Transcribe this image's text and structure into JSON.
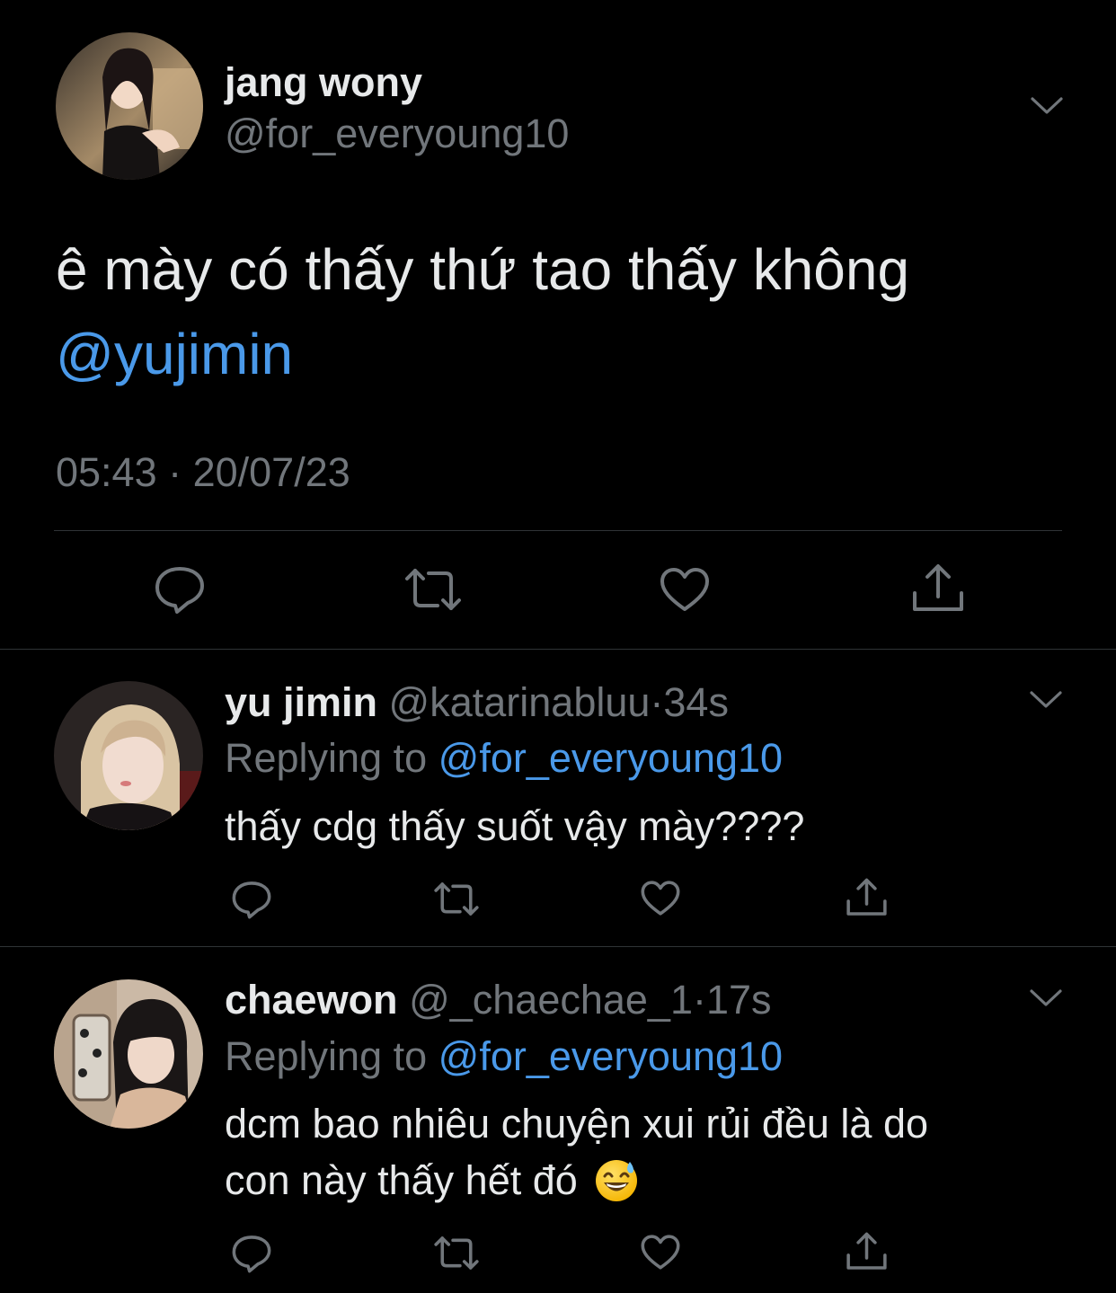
{
  "main_tweet": {
    "avatar_icon": "user-avatar-photo",
    "display_name": "jang wony",
    "handle": "@for_everyoung10",
    "text": "ê mày có thấy thứ tao thấy không",
    "mention": "@yujimin",
    "timestamp": "05:43 · 20/07/23",
    "actions": [
      "reply-icon",
      "retweet-icon",
      "like-icon",
      "share-icon"
    ]
  },
  "replies": [
    {
      "display_name": "yu jimin",
      "handle": "@katarinabluu",
      "separator": "·",
      "age": "34s",
      "replying_prefix": "Replying to",
      "replying_to": "@for_everyoung10",
      "text": "thấy cdg thấy suốt vậy mày????"
    },
    {
      "display_name": "chaewon",
      "handle": "@_chaechae_1",
      "separator": "·",
      "age": "17s",
      "replying_prefix": "Replying to",
      "replying_to": "@for_everyoung10",
      "text_line1": "dcm bao nhiêu chuyện xui rủi đều là do",
      "text_line2": "con này thấy hết đó",
      "emoji": "😅"
    }
  ],
  "colors": {
    "background": "#000000",
    "text": "#e7e9ea",
    "muted": "#71767b",
    "link": "#4a99e9",
    "divider": "#2f3336"
  }
}
